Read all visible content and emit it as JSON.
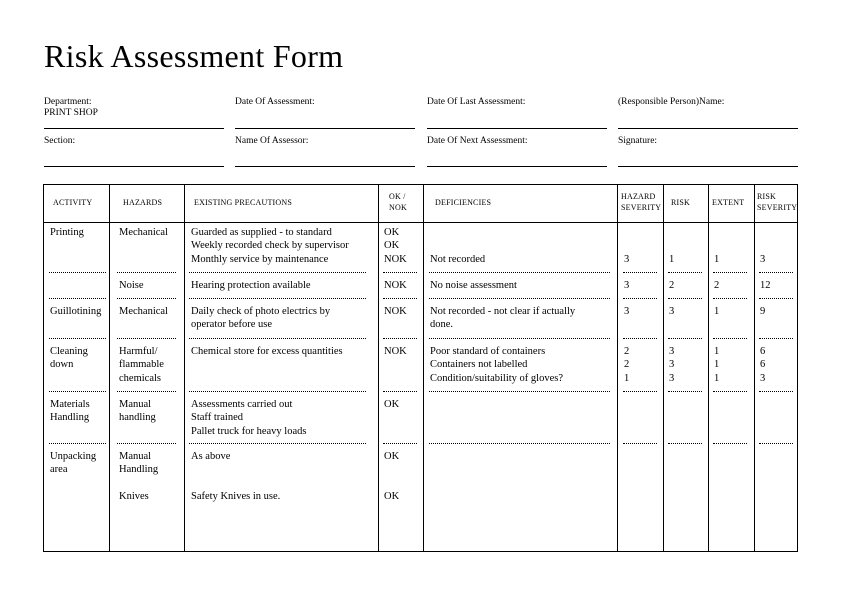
{
  "title": "Risk Assessment Form",
  "fields": {
    "department": {
      "label": "Department:",
      "value": "PRINT SHOP"
    },
    "date_of_assessment": {
      "label": "Date Of Assessment:",
      "value": ""
    },
    "date_of_last_assessment": {
      "label": "Date Of Last Assessment:",
      "value": ""
    },
    "responsible_person": {
      "label": "(Responsible Person)Name:",
      "value": ""
    },
    "section": {
      "label": "Section:",
      "value": ""
    },
    "name_of_assessor": {
      "label": "Name Of Assessor:",
      "value": ""
    },
    "date_of_next_assessment": {
      "label": "Date Of Next Assessment:",
      "value": ""
    },
    "signature": {
      "label": "Signature:",
      "value": ""
    }
  },
  "table": {
    "headers": {
      "activity": "ACTIVITY",
      "hazards": "HAZARDS",
      "precautions": "EXISTING PRECAUTIONS",
      "ok_nok_1": "OK /",
      "ok_nok_2": "NOK",
      "deficiencies": "DEFICIENCIES",
      "hazard_severity_1": "HAZARD",
      "hazard_severity_2": "SEVERITY",
      "risk": "RISK",
      "extent": "EXTENT",
      "risk_severity_1": "RISK",
      "risk_severity_2": "SEVERITY"
    },
    "rows": [
      {
        "activity": "Printing",
        "hazard": "Mechanical",
        "precautions": [
          "Guarded as supplied - to standard",
          "Weekly recorded check by supervisor",
          "Monthly service by maintenance"
        ],
        "ok": [
          "OK",
          "OK",
          "NOK"
        ],
        "deficiencies": [
          "Not recorded"
        ],
        "hazard_severity": [
          "3"
        ],
        "risk": [
          "1"
        ],
        "extent": [
          "1"
        ],
        "risk_severity": [
          "3"
        ]
      },
      {
        "activity": "",
        "hazard": "Noise",
        "precautions": [
          "Hearing protection available"
        ],
        "ok": [
          "NOK"
        ],
        "deficiencies": [
          "No noise assessment"
        ],
        "hazard_severity": [
          "3"
        ],
        "risk": [
          "2"
        ],
        "extent": [
          "2"
        ],
        "risk_severity": [
          "12"
        ]
      },
      {
        "activity": "Guillotining",
        "hazard": "Mechanical",
        "precautions": [
          "Daily check of photo electrics by",
          "operator before use"
        ],
        "ok": [
          "NOK"
        ],
        "deficiencies": [
          "Not recorded - not clear if actually",
          "done."
        ],
        "hazard_severity": [
          "3"
        ],
        "risk": [
          "3"
        ],
        "extent": [
          "1"
        ],
        "risk_severity": [
          "9"
        ]
      },
      {
        "activity": "Cleaning\ndown",
        "hazard": "Harmful/\nflammable\nchemicals",
        "precautions": [
          "Chemical store for excess quantities"
        ],
        "ok": [
          "NOK"
        ],
        "deficiencies": [
          "Poor standard of containers",
          "Containers not labelled",
          "Condition/suitability of gloves?"
        ],
        "hazard_severity": [
          "2",
          "2",
          "1"
        ],
        "risk": [
          "3",
          "3",
          "3"
        ],
        "extent": [
          "1",
          "1",
          "1"
        ],
        "risk_severity": [
          "6",
          "6",
          "3"
        ]
      },
      {
        "activity": "Materials\nHandling",
        "hazard": "Manual\nhandling",
        "precautions": [
          "Assessments carried out",
          "Staff trained",
          "Pallet truck for heavy loads"
        ],
        "ok": [
          "OK"
        ],
        "deficiencies": [],
        "hazard_severity": [],
        "risk": [],
        "extent": [],
        "risk_severity": []
      },
      {
        "activity": "Unpacking\narea",
        "hazard": "Manual\nHandling",
        "precautions": [
          "As above"
        ],
        "ok": [
          "OK"
        ],
        "deficiencies": [],
        "hazard_severity": [],
        "risk": [],
        "extent": [],
        "risk_severity": []
      },
      {
        "activity": "",
        "hazard": "Knives",
        "precautions": [
          "Safety Knives in use."
        ],
        "ok": [
          "OK"
        ],
        "deficiencies": [],
        "hazard_severity": [],
        "risk": [],
        "extent": [],
        "risk_severity": []
      }
    ]
  }
}
